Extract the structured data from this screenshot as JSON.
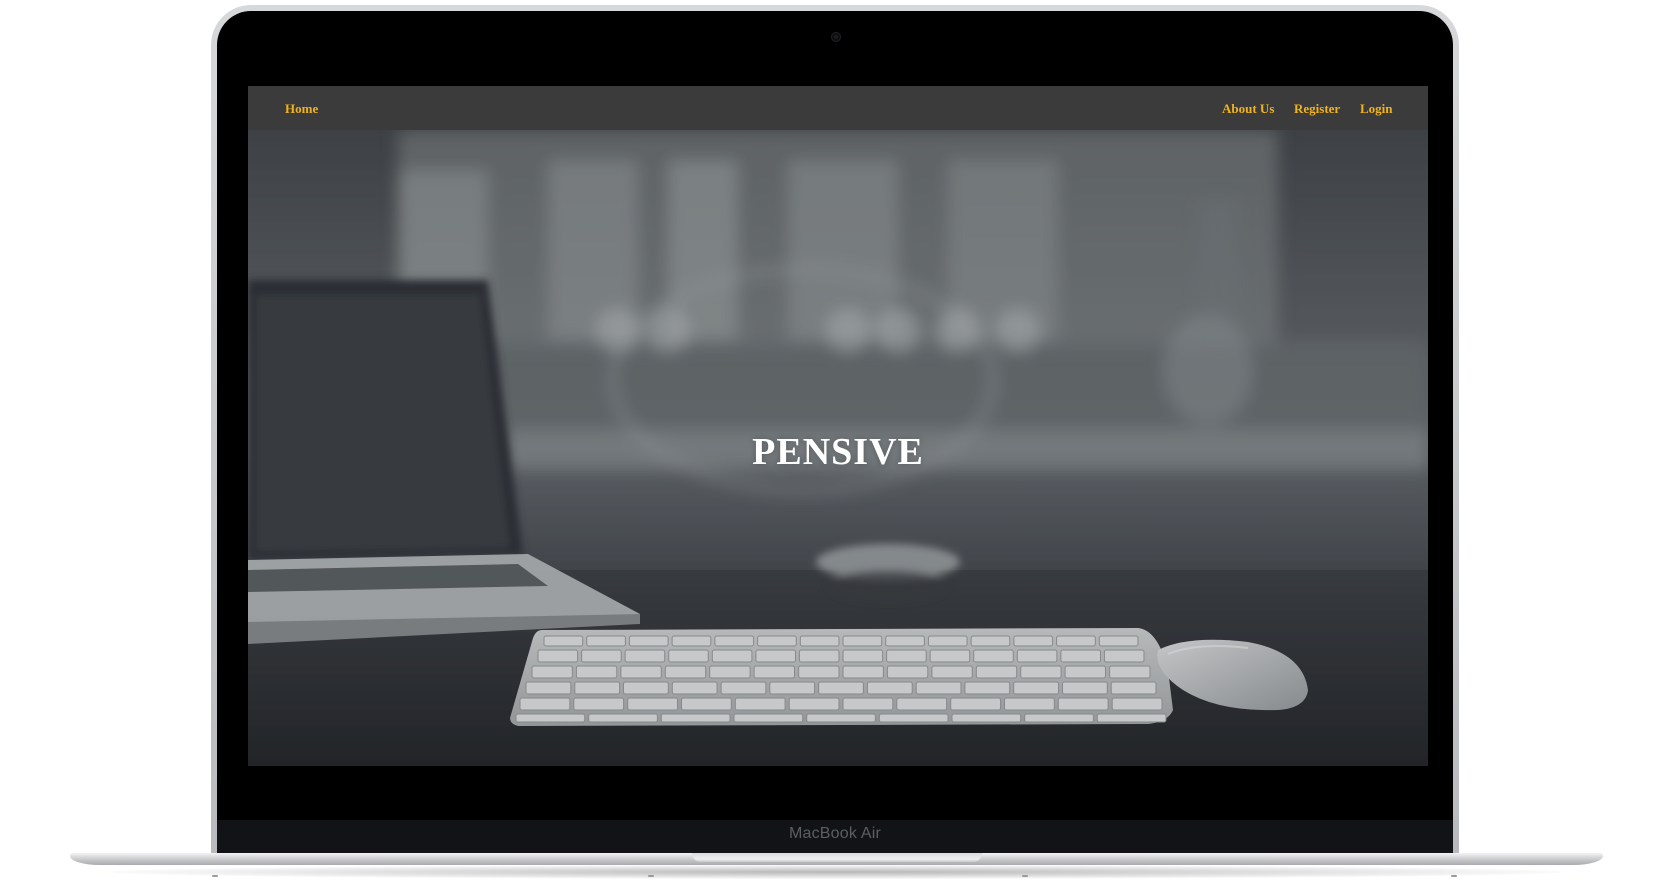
{
  "device": {
    "label": "MacBook Air"
  },
  "nav": {
    "home_label": "Home",
    "about_label": "About Us",
    "register_label": "Register",
    "login_label": "Login",
    "link_color": "#f0b21f",
    "bar_color": "#3b3b3b"
  },
  "hero": {
    "title": "PENSIVE",
    "background_description_icon": "desk-photo-image"
  }
}
